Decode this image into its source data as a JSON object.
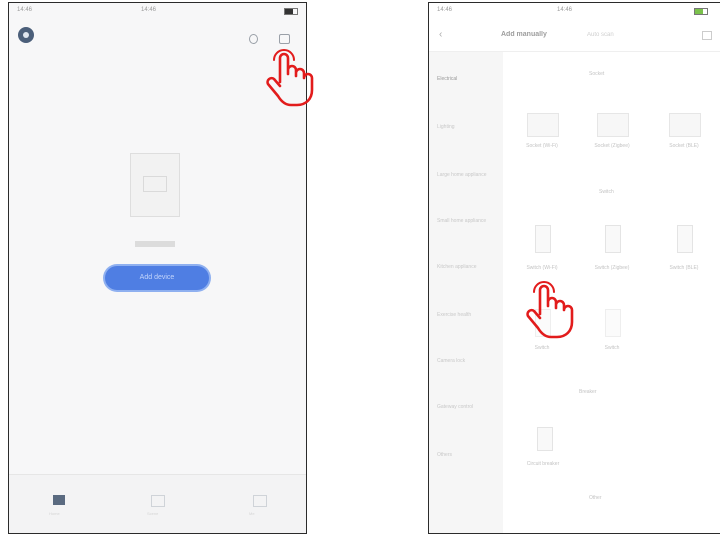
{
  "accent_color": "#4f7ee3",
  "pointer_color": "#e21c1c",
  "left_phone": {
    "status": {
      "time": "14:46",
      "clock": "14:46",
      "signal": "●●●"
    },
    "empty_state_text": "No devices",
    "add_button_label": "Add device",
    "tabs": [
      {
        "icon": "home-icon",
        "label": "Home"
      },
      {
        "icon": "scene-icon",
        "label": "Scene"
      },
      {
        "icon": "profile-icon",
        "label": "Me"
      }
    ]
  },
  "right_phone": {
    "status": {
      "time": "14:46",
      "clock": "14:46"
    },
    "nav": {
      "title": "Add manually",
      "subtitle": "Auto scan"
    },
    "sidebar": [
      "Electrical",
      "Lighting",
      "Large home appliance",
      "Small home appliance",
      "Kitchen appliance",
      "Exercise health",
      "Camera lock",
      "Gateway control",
      "Others"
    ],
    "sections": [
      "Socket",
      "Switch",
      "Breaker"
    ],
    "cards_row1": [
      "Socket (Wi-Fi)",
      "Socket (Zigbee)",
      "Socket (BLE)"
    ],
    "cards_row2": [
      "Switch (Wi-Fi)",
      "Switch (Zigbee)",
      "Switch (BLE)"
    ],
    "cards_row3": [
      "Switch",
      "Switch"
    ],
    "cards_row4": [
      "Circuit breaker"
    ],
    "footer": "Other"
  }
}
